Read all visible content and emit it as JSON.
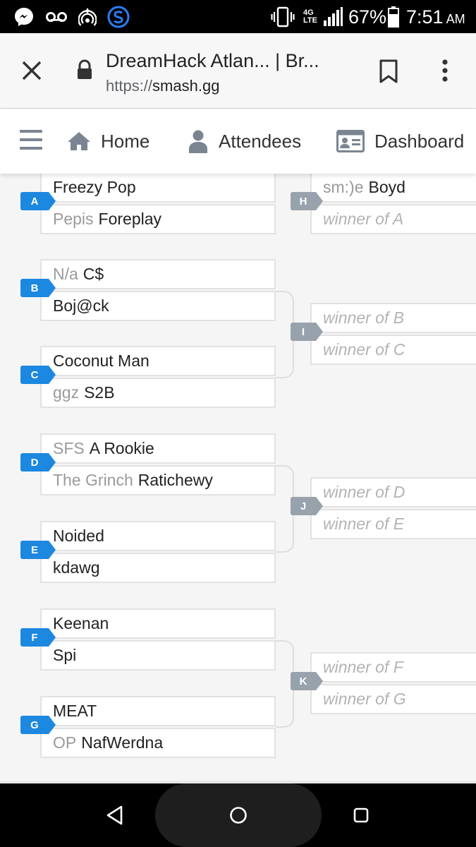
{
  "status_bar": {
    "icons": [
      "messenger-icon",
      "voicemail-icon",
      "hotspot-icon",
      "s-app-icon",
      "vibrate-icon",
      "4g-lte-icon",
      "signal-icon",
      "battery-icon"
    ],
    "network": "4G LTE",
    "battery": "67%",
    "time": "7:51",
    "ampm": "AM"
  },
  "browser": {
    "title": "DreamHack Atlan... | Br...",
    "url_scheme": "https://",
    "url_host": "smash.gg"
  },
  "site_nav": {
    "items": [
      {
        "label": "Home",
        "icon": "home-icon"
      },
      {
        "label": "Attendees",
        "icon": "person-icon"
      },
      {
        "label": "Dashboard",
        "icon": "id-card-icon"
      }
    ]
  },
  "bracket": {
    "round1": [
      {
        "id": "A",
        "p1": {
          "prefix": "",
          "name": "Freezy Pop"
        },
        "p2": {
          "prefix": "Pepis",
          "name": "Foreplay"
        }
      },
      {
        "id": "B",
        "p1": {
          "prefix": "N/a",
          "name": "C$"
        },
        "p2": {
          "prefix": "",
          "name": "Boj@ck"
        }
      },
      {
        "id": "C",
        "p1": {
          "prefix": "",
          "name": "Coconut Man"
        },
        "p2": {
          "prefix": "ggz",
          "name": "S2B"
        }
      },
      {
        "id": "D",
        "p1": {
          "prefix": "SFS",
          "name": "A Rookie"
        },
        "p2": {
          "prefix": "The Grinch",
          "name": "Ratichewy"
        }
      },
      {
        "id": "E",
        "p1": {
          "prefix": "",
          "name": "Noided"
        },
        "p2": {
          "prefix": "",
          "name": "kdawg"
        }
      },
      {
        "id": "F",
        "p1": {
          "prefix": "",
          "name": "Keenan"
        },
        "p2": {
          "prefix": "",
          "name": "Spi"
        }
      },
      {
        "id": "G",
        "p1": {
          "prefix": "",
          "name": "MEAT"
        },
        "p2": {
          "prefix": "OP",
          "name": "NafWerdna"
        }
      }
    ],
    "round2": [
      {
        "id": "H",
        "p1": {
          "prefix": "sm:)e",
          "name": "Boyd"
        },
        "p2": {
          "prefix": "",
          "name": "winner of A"
        }
      },
      {
        "id": "I",
        "p1": {
          "prefix": "",
          "name": "winner of B"
        },
        "p2": {
          "prefix": "",
          "name": "winner of C"
        }
      },
      {
        "id": "J",
        "p1": {
          "prefix": "",
          "name": "winner of D"
        },
        "p2": {
          "prefix": "",
          "name": "winner of E"
        }
      },
      {
        "id": "K",
        "p1": {
          "prefix": "",
          "name": "winner of F"
        },
        "p2": {
          "prefix": "",
          "name": "winner of G"
        }
      }
    ]
  },
  "android_nav": {
    "buttons": [
      "back-icon",
      "home-circle-icon",
      "recents-icon"
    ]
  }
}
